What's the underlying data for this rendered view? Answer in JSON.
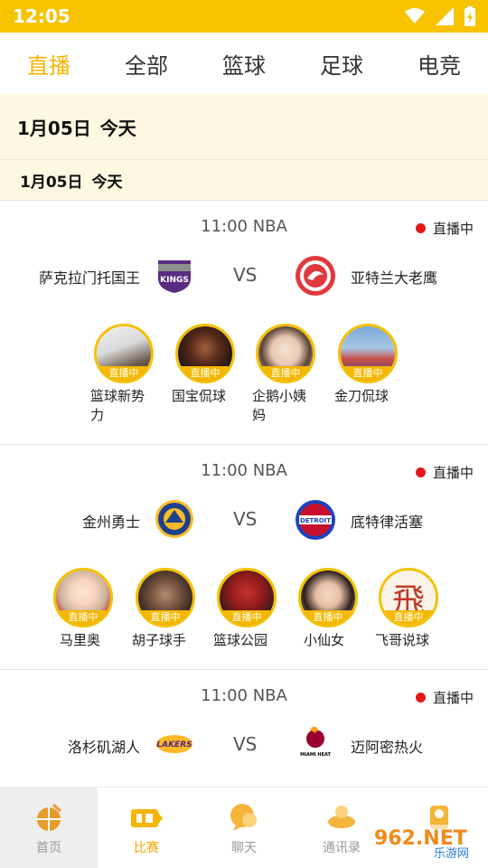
{
  "status_bar": {
    "time": "12:05",
    "icons": [
      "wifi-icon",
      "signal-icon",
      "battery-icon"
    ]
  },
  "tabs": [
    {
      "label": "直播",
      "active": true
    },
    {
      "label": "全部",
      "active": false
    },
    {
      "label": "篮球",
      "active": false
    },
    {
      "label": "足球",
      "active": false
    },
    {
      "label": "电竞",
      "active": false
    }
  ],
  "date_header": {
    "date": "1月05日",
    "day": "今天"
  },
  "date_sub": {
    "date": "1月05日",
    "day": "今天"
  },
  "matches": [
    {
      "time": "11:00 NBA",
      "status": "直播中",
      "home": "萨克拉门托国王",
      "vs": "VS",
      "away": "亚特兰大老鹰",
      "home_logo": "kings-logo-icon",
      "away_logo": "hawks-logo-icon",
      "streamers": [
        {
          "name": "篮球新势力",
          "tag": "直播中"
        },
        {
          "name": "国宝侃球",
          "tag": "直播中"
        },
        {
          "name": "企鹅小姨妈",
          "tag": "直播中"
        },
        {
          "name": "金刀侃球",
          "tag": "直播中"
        }
      ]
    },
    {
      "time": "11:00 NBA",
      "status": "直播中",
      "home": "金州勇士",
      "vs": "VS",
      "away": "底特律活塞",
      "home_logo": "warriors-logo-icon",
      "away_logo": "pistons-logo-icon",
      "streamers": [
        {
          "name": "马里奥",
          "tag": "直播中"
        },
        {
          "name": "胡子球手",
          "tag": "直播中"
        },
        {
          "name": "篮球公园",
          "tag": "直播中"
        },
        {
          "name": "小仙女",
          "tag": "直播中"
        },
        {
          "name": "飞哥说球",
          "tag": "直播中",
          "avatar_char": "飛"
        }
      ]
    },
    {
      "time": "11:00 NBA",
      "status": "直播中",
      "home": "洛杉矶湖人",
      "vs": "VS",
      "away": "迈阿密热火",
      "home_logo": "lakers-logo-icon",
      "away_logo": "heat-logo-icon",
      "logo_text": {
        "lakers": "LAKERS",
        "heat": "MIAMI HEAT"
      }
    }
  ],
  "bottom_nav": [
    {
      "label": "首页",
      "icon": "home-basketball-icon"
    },
    {
      "label": "比赛",
      "icon": "match-ticket-icon",
      "active": true
    },
    {
      "label": "聊天",
      "icon": "chat-bubble-icon"
    },
    {
      "label": "通讯录",
      "icon": "contacts-icon"
    },
    {
      "label": "",
      "icon": "profile-icon"
    }
  ],
  "watermark": {
    "text": "962.NET",
    "sub": "乐游网"
  },
  "colors": {
    "accent": "#f5b400",
    "status_bar": "#f7c300",
    "live_dot": "#e5161a",
    "date_bg": "#fff8e1"
  }
}
